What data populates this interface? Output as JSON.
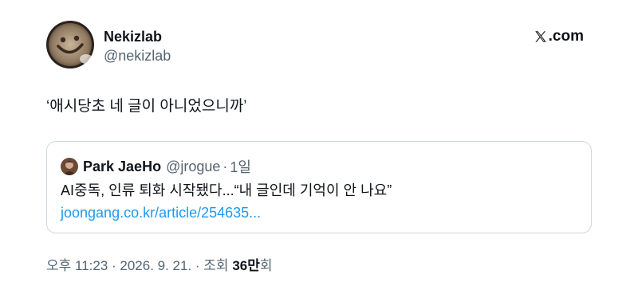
{
  "author": {
    "name": "Nekizlab",
    "handle": "@nekizlab",
    "avatar_icon": "smiley-latte-avatar"
  },
  "brand": {
    "label": ".com",
    "icon": "x-logo-icon"
  },
  "tweet": {
    "text": "‘애시당초 네 글이 아니었으니까’"
  },
  "quote": {
    "author_name": "Park JaeHo",
    "author_handle": "@jrogue",
    "separator": "·",
    "time": "1일",
    "text": "AI중독, 인류 퇴화 시작됐다...“내 글인데 기억이 안 나요”",
    "link": "joongang.co.kr/article/254635..."
  },
  "meta": {
    "prefix": "오후 11:23 · 2026. 9. 21. · 조회 ",
    "views": "36만",
    "suffix": "회"
  },
  "colors": {
    "text": "#0f1419",
    "secondary": "#536471",
    "link": "#1d9bf0",
    "border": "#cfd9de"
  }
}
